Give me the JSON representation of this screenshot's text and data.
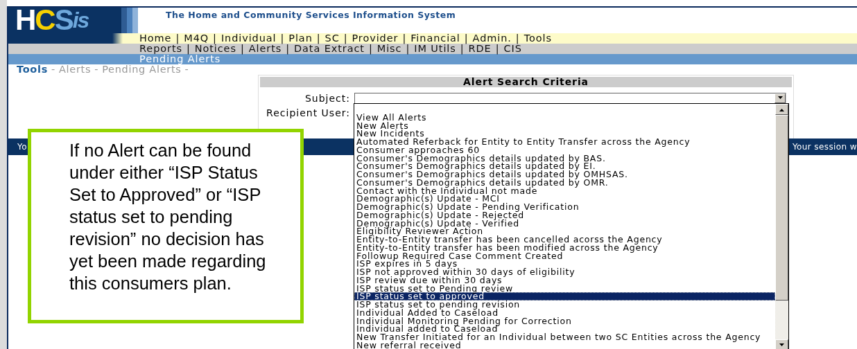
{
  "header": {
    "logo": [
      {
        "text": "H",
        "color": "#ffffff"
      },
      {
        "text": "C",
        "color": "#f5d000"
      },
      {
        "text": "S",
        "color": "#6ea8dc"
      },
      {
        "text": "is",
        "color": "#6ea8dc"
      }
    ],
    "title": "The Home and Community Services Information System"
  },
  "menus": {
    "separator": "|",
    "primary": [
      "Home",
      "M4Q",
      "Individual",
      "Plan",
      "SC",
      "Provider",
      "Financial",
      "Admin.",
      "Tools"
    ],
    "secondary": [
      "Reports",
      "Notices",
      "Alerts",
      "Data Extract",
      "Misc",
      "IM Utils",
      "RDE",
      "CIS"
    ],
    "submenu": [
      "Pending Alerts"
    ]
  },
  "breadcrumb": {
    "separator": "-",
    "items": [
      {
        "label": "Tools",
        "kind": "root"
      },
      {
        "label": "Alerts",
        "kind": "link"
      },
      {
        "label": "Pending Alerts",
        "kind": "link"
      }
    ]
  },
  "criteria": {
    "title": "Alert Search Criteria",
    "subject_label": "Subject:",
    "recipient_label": "Recipient User:"
  },
  "subject_options": [
    {
      "label": "View All Alerts",
      "selected": false
    },
    {
      "label": "New Alerts",
      "selected": false
    },
    {
      "label": "New Incidents",
      "selected": false
    },
    {
      "label": "Automated Referback for Entity to Entity Transfer across the Agency",
      "selected": false
    },
    {
      "label": "Consumer approaches 60",
      "selected": false
    },
    {
      "label": "Consumer's Demographics details updated by BAS.",
      "selected": false
    },
    {
      "label": "Consumer's Demographics details updated by EI.",
      "selected": false
    },
    {
      "label": "Consumer's Demographics details updated by OMHSAS.",
      "selected": false
    },
    {
      "label": "Consumer's Demographics details updated by OMR.",
      "selected": false
    },
    {
      "label": "Contact with the Individual not made",
      "selected": false
    },
    {
      "label": "Demographic(s) Update - MCI",
      "selected": false
    },
    {
      "label": "Demographic(s) Update - Pending Verification",
      "selected": false
    },
    {
      "label": "Demographic(s) Update - Rejected",
      "selected": false
    },
    {
      "label": "Demographic(s) Update - Verified",
      "selected": false
    },
    {
      "label": "Eligibility Reviewer Action",
      "selected": false
    },
    {
      "label": "Entity-to-Entity transfer has been cancelled acorss the Agency",
      "selected": false
    },
    {
      "label": "Entity-to-Entity transfer has been modified across the Agency",
      "selected": false
    },
    {
      "label": "Followup Required Case Comment Created",
      "selected": false
    },
    {
      "label": "ISP expires in 5 days",
      "selected": false
    },
    {
      "label": "ISP not approved within 30 days of eligibility",
      "selected": false
    },
    {
      "label": "ISP review due within 30 days",
      "selected": false
    },
    {
      "label": "ISP status set to Pending review",
      "selected": false
    },
    {
      "label": "ISP status set to approved",
      "selected": true
    },
    {
      "label": "ISP status set to pending revision",
      "selected": false
    },
    {
      "label": "Individual Added to Caseload",
      "selected": false
    },
    {
      "label": "Individual Monitoring Pending for Correction",
      "selected": false
    },
    {
      "label": "Individual added to Caseload",
      "selected": false
    },
    {
      "label": "New Transfer Initiated for an Individual between two SC Entities across the Agency",
      "selected": false
    },
    {
      "label": "New referral received",
      "selected": false
    }
  ],
  "session_bar": {
    "left_text": "Yo",
    "right_text": "Your session w"
  },
  "callout": {
    "text": "If no Alert can be found under either “ISP Status Set to Approved” or “ISP status set to pending revision” no decision has yet been made regarding this consumers plan."
  }
}
